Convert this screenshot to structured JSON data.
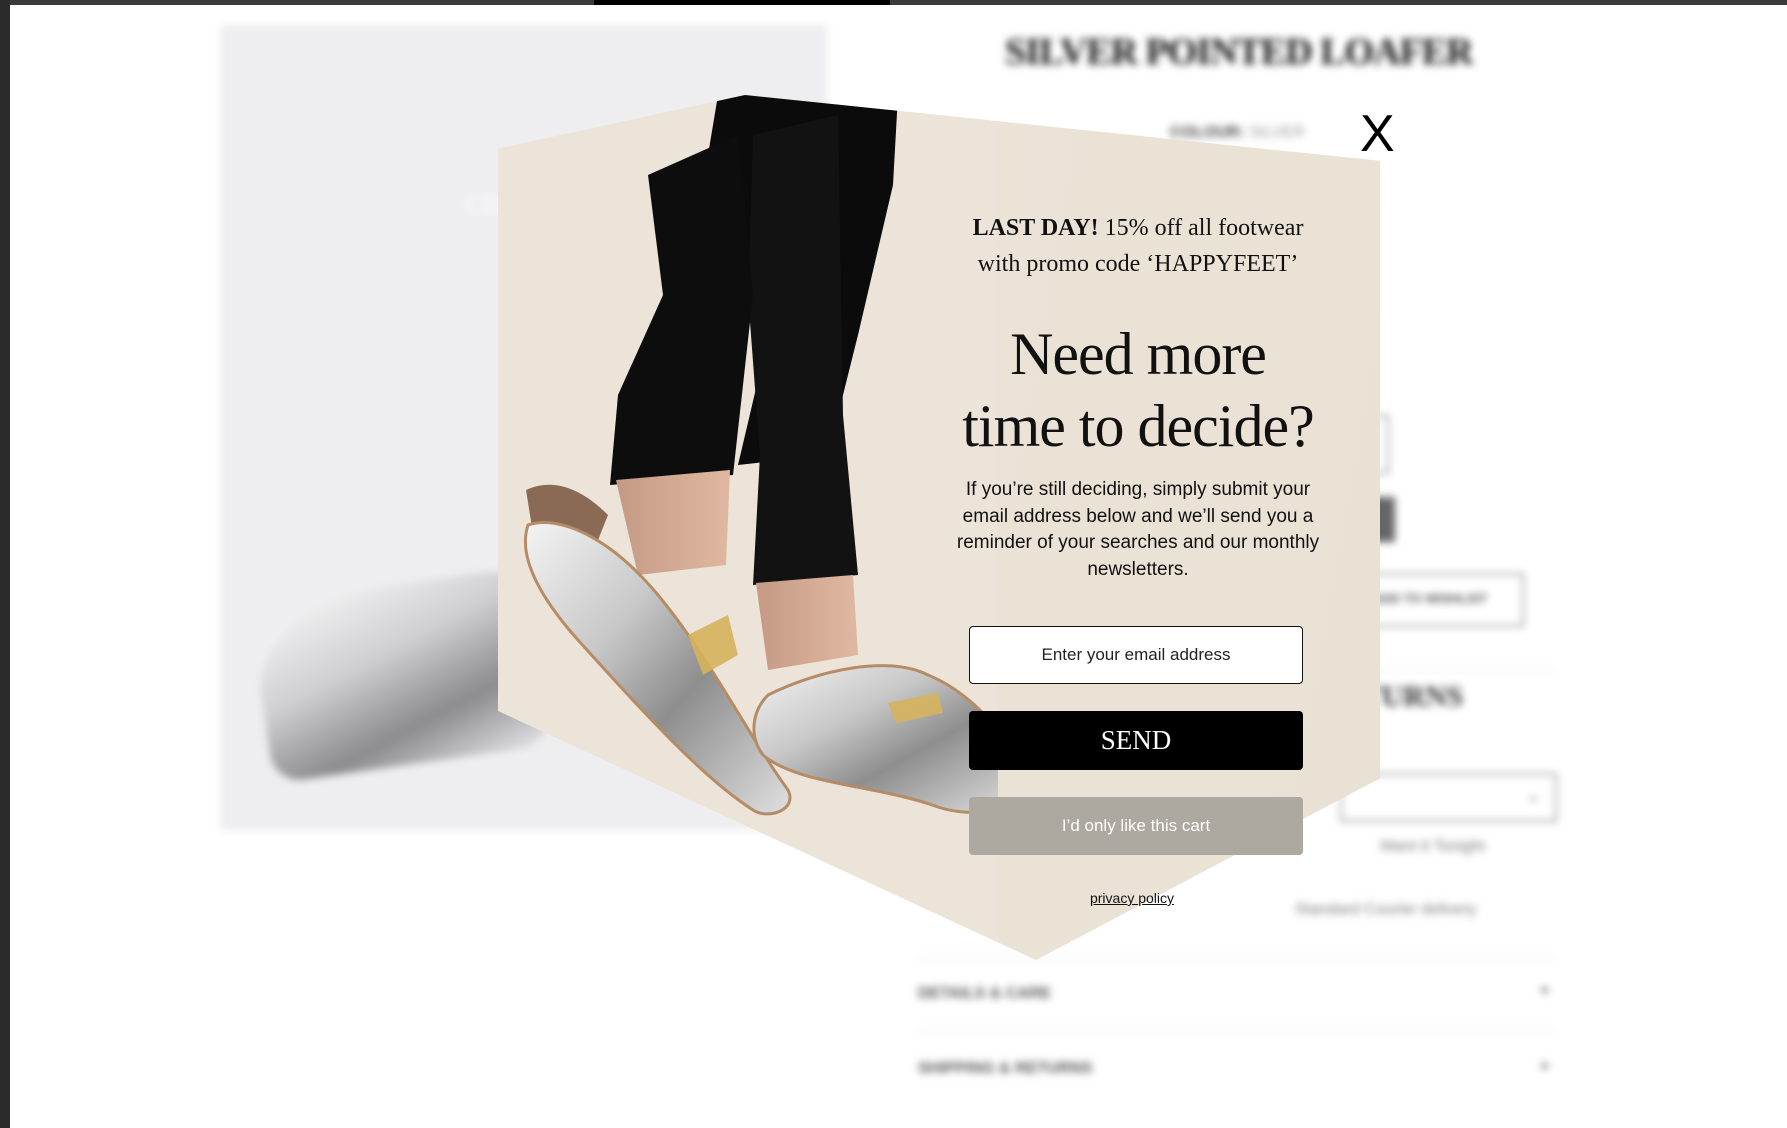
{
  "background_page": {
    "product_title": "SILVER POINTED LOAFER",
    "colour_label": "COLOUR:",
    "colour_value": "SILVER",
    "image_caption": "CH",
    "wishlist_label": "ADD TO WISHLIST",
    "returns_heading": "RETURNS",
    "delivery_option": "Want it Tonight",
    "delivery_note": "Standard Courier delivery",
    "accordion_details": "DETAILS & CARE",
    "accordion_shipping": "SHIPPING & RETURNS",
    "accordion_icon": "+"
  },
  "popup": {
    "close_label": "X",
    "promo_bold": "LAST DAY!",
    "promo_line1_rest": " 15% off all footwear",
    "promo_line2": "with promo code ‘HAPPYFEET’",
    "headline_line1": "Need more",
    "headline_line2": "time to decide?",
    "body": "If you’re still deciding, simply submit your email address below and we’ll send you a reminder of your searches and our monthly newsletters.",
    "email_placeholder": "Enter your email address",
    "send_label": "SEND",
    "cart_label": "I’d only like this cart",
    "privacy_label": "privacy policy"
  },
  "colors": {
    "popup_background": "#ebe3d6",
    "send_button": "#000000",
    "cart_button": "#ada9a1",
    "product_image_background": "#eeeef0"
  },
  "icons": {
    "close": "close-icon",
    "accordion_expand": "plus-icon"
  }
}
